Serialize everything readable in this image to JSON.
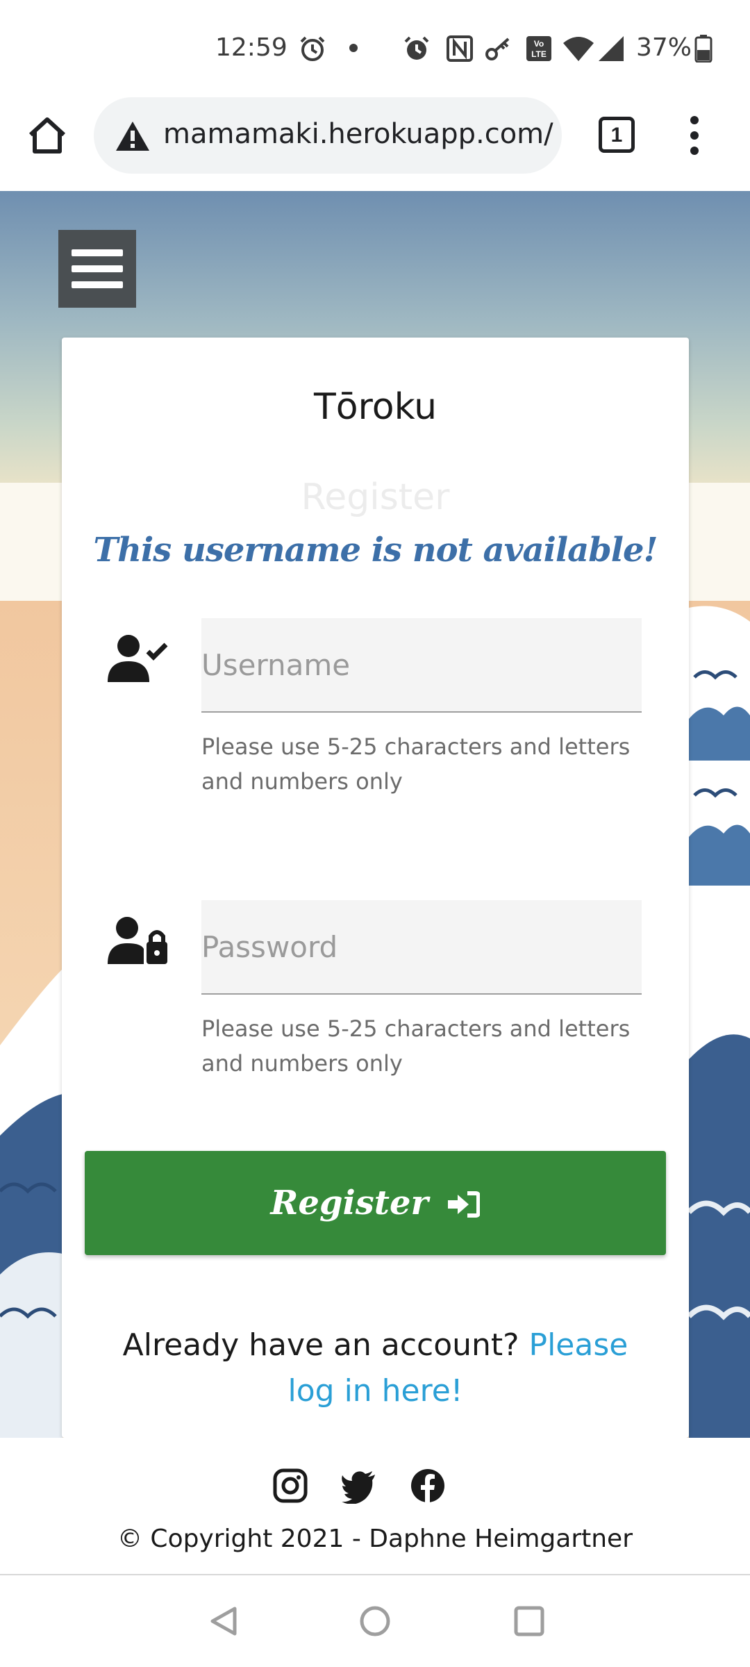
{
  "status_bar": {
    "time": "12:59",
    "battery": "37%",
    "icons": [
      "alarm-icon",
      "dot-icon",
      "alarm-icon",
      "nfc-icon",
      "key-icon",
      "volte-icon",
      "wifi-icon",
      "signal-icon",
      "battery-icon"
    ]
  },
  "browser": {
    "url": "mamamaki.herokuapp.com/",
    "tab_count": "1",
    "icons": [
      "home-icon",
      "warning-icon",
      "tabs-icon",
      "more-vert-icon"
    ]
  },
  "page": {
    "title": "Tōroku",
    "subtitle": "Register",
    "flash_message": "This username is not available!",
    "username": {
      "placeholder": "Username",
      "helper": "Please use 5-25 characters and letters and numbers only",
      "icon": "user-check-icon"
    },
    "password": {
      "placeholder": "Password",
      "helper": "Please use 5-25 characters and letters and numbers only",
      "icon": "user-lock-icon"
    },
    "register_button": "Register",
    "login_prompt": "Already have an account?",
    "login_link": "Please log in here!",
    "colors": {
      "button": "#368a3a",
      "flash": "#3c6fa8",
      "link": "#2a9fd6"
    }
  },
  "footer": {
    "social": [
      "instagram-icon",
      "twitter-icon",
      "facebook-icon"
    ],
    "copyright": "© Copyright 2021 - Daphne Heimgartner"
  },
  "nav": {
    "buttons": [
      "back-icon",
      "home-circle-icon",
      "recents-icon"
    ]
  }
}
